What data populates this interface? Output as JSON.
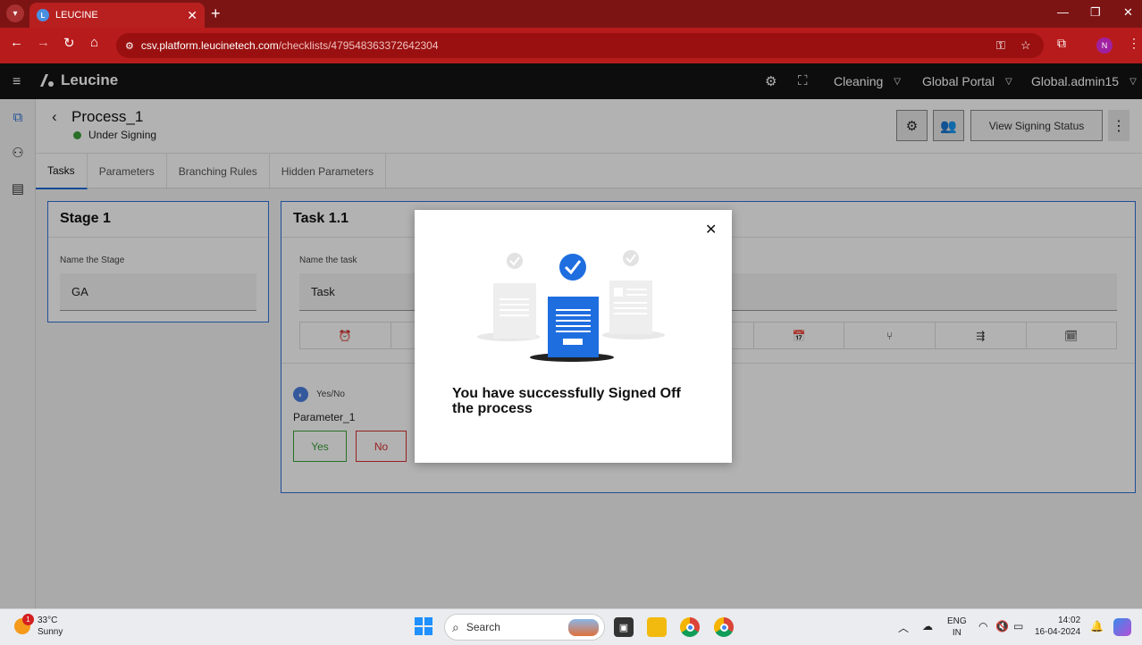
{
  "browser": {
    "tab_title": "LEUCINE",
    "url_domain": "csv.platform.leucinetech.com",
    "url_path": "/checklists/479548363372642304",
    "profile_initial": "N",
    "tab_close": "✕",
    "new_tab": "+"
  },
  "app_header": {
    "logo_text": "Leucine",
    "menus": [
      {
        "label": "Cleaning"
      },
      {
        "label": "Global Portal"
      },
      {
        "label": "Global.admin15"
      }
    ]
  },
  "page": {
    "title": "Process_1",
    "status": "Under Signing",
    "status_color": "#3ba03b",
    "view_signing_status_label": "View Signing Status",
    "tabs": [
      {
        "label": "Tasks",
        "active": true
      },
      {
        "label": "Parameters"
      },
      {
        "label": "Branching Rules"
      },
      {
        "label": "Hidden Parameters"
      }
    ]
  },
  "stage": {
    "title": "Stage 1",
    "name_label": "Name the Stage",
    "name_value": "GA"
  },
  "task": {
    "title": "Task 1.1",
    "name_label": "Name the task",
    "name_value": "Task",
    "toolbar_icons": [
      "alarm-icon",
      "calendar-clock-icon",
      "branch-icon",
      "flow-icon",
      "calendar-lock-icon"
    ],
    "parameter": {
      "type": "Yes/No",
      "name": "Parameter_1",
      "yes_label": "Yes",
      "no_label": "No"
    }
  },
  "modal": {
    "message": "You have successfully Signed Off the process",
    "accent_color": "#1e6ee0"
  },
  "taskbar": {
    "temperature": "33°C",
    "weather": "Sunny",
    "weather_badge": "1",
    "search_placeholder": "Search",
    "lang_1": "ENG",
    "lang_2": "IN",
    "time": "14:02",
    "date": "16-04-2024"
  }
}
